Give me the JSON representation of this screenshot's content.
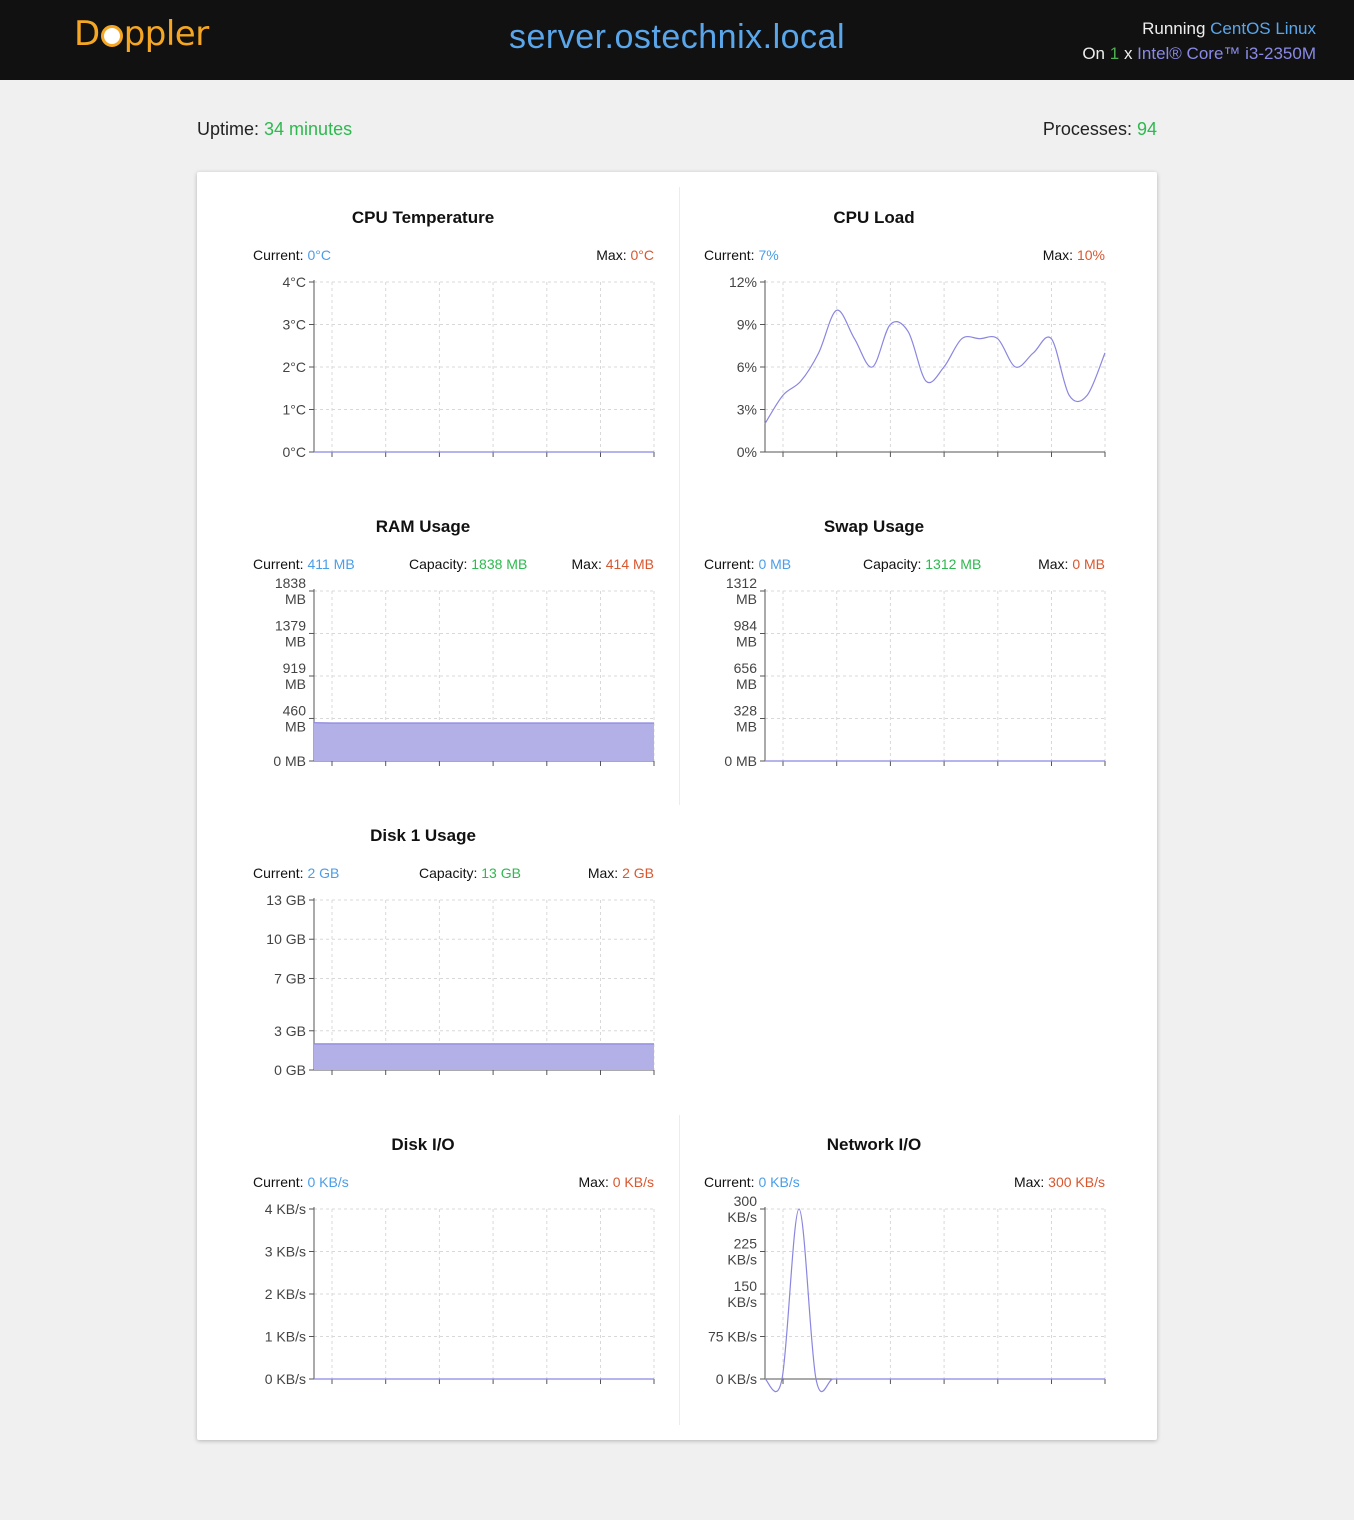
{
  "header": {
    "logo_text_before": "D",
    "logo_text_after": "ppler",
    "hostname": "server.ostechnix.local",
    "running_label": "Running",
    "os_name": "CentOS Linux",
    "on_label": "On",
    "cpu_count": "1",
    "x_label": "x",
    "cpu_model": "Intel® Core™ i3-2350M"
  },
  "stats": {
    "uptime_label": "Uptime:",
    "uptime_value": "34 minutes",
    "processes_label": "Processes:",
    "processes_value": "94"
  },
  "colors": {
    "current": "#4a9ee8",
    "capacity": "#2eb84f",
    "max": "#d9572e",
    "series_line": "#8a86e0",
    "series_fill": "#b3b0e8"
  },
  "panels": {
    "cpu_temp": {
      "title": "CPU Temperature",
      "current_label": "Current:",
      "current_value": "0°C",
      "max_label": "Max:",
      "max_value": "0°C"
    },
    "cpu_load": {
      "title": "CPU Load",
      "current_label": "Current:",
      "current_value": "7%",
      "max_label": "Max:",
      "max_value": "10%"
    },
    "ram": {
      "title": "RAM Usage",
      "current_label": "Current:",
      "current_value": "411 MB",
      "capacity_label": "Capacity:",
      "capacity_value": "1838 MB",
      "max_label": "Max:",
      "max_value": "414 MB"
    },
    "swap": {
      "title": "Swap Usage",
      "current_label": "Current:",
      "current_value": "0 MB",
      "capacity_label": "Capacity:",
      "capacity_value": "1312 MB",
      "max_label": "Max:",
      "max_value": "0 MB"
    },
    "disk1": {
      "title": "Disk 1 Usage",
      "current_label": "Current:",
      "current_value": "2 GB",
      "capacity_label": "Capacity:",
      "capacity_value": "13 GB",
      "max_label": "Max:",
      "max_value": "2 GB"
    },
    "disk_io": {
      "title": "Disk I/O",
      "current_label": "Current:",
      "current_value": "0 KB/s",
      "max_label": "Max:",
      "max_value": "0 KB/s"
    },
    "net_io": {
      "title": "Network I/O",
      "current_label": "Current:",
      "current_value": "0 KB/s",
      "max_label": "Max:",
      "max_value": "300 KB/s"
    }
  },
  "chart_data": [
    {
      "id": "cpu_temp",
      "type": "line",
      "title": "CPU Temperature",
      "ylim": [
        0,
        4
      ],
      "yticks": [
        0,
        1,
        2,
        3,
        4
      ],
      "ytick_labels": [
        "0°C",
        "1°C",
        "2°C",
        "3°C",
        "4°C"
      ],
      "series": [
        {
          "values": [
            0,
            0,
            0,
            0,
            0,
            0,
            0,
            0,
            0,
            0,
            0,
            0,
            0,
            0,
            0,
            0,
            0,
            0,
            0,
            0,
            0
          ]
        }
      ],
      "fill": false,
      "grid": true
    },
    {
      "id": "cpu_load",
      "type": "line",
      "title": "CPU Load",
      "ylim": [
        0,
        12
      ],
      "yticks": [
        0,
        3,
        6,
        9,
        12
      ],
      "ytick_labels": [
        "0%",
        "3%",
        "6%",
        "9%",
        "12%"
      ],
      "series": [
        {
          "values": [
            2,
            4,
            5,
            7,
            10,
            8,
            6,
            9,
            8.5,
            5,
            6,
            8,
            8,
            8,
            6,
            7,
            8,
            4,
            4,
            7
          ]
        }
      ],
      "fill": false,
      "grid": true
    },
    {
      "id": "ram",
      "type": "area",
      "title": "RAM Usage",
      "ylim": [
        0,
        1838
      ],
      "yticks": [
        0,
        460,
        919,
        1379,
        1838
      ],
      "ytick_labels": [
        [
          "0 MB"
        ],
        [
          "460",
          "MB"
        ],
        [
          "919",
          "MB"
        ],
        [
          "1379",
          "MB"
        ],
        [
          "1838",
          "MB"
        ]
      ],
      "series": [
        {
          "values": [
            414,
            411,
            411,
            411,
            411,
            411,
            411,
            411,
            411,
            411,
            411,
            411,
            411,
            411,
            411,
            411,
            411,
            411,
            411,
            411,
            411
          ]
        }
      ],
      "fill": true,
      "grid": true
    },
    {
      "id": "swap",
      "type": "area",
      "title": "Swap Usage",
      "ylim": [
        0,
        1312
      ],
      "yticks": [
        0,
        328,
        656,
        984,
        1312
      ],
      "ytick_labels": [
        [
          "0 MB"
        ],
        [
          "328",
          "MB"
        ],
        [
          "656",
          "MB"
        ],
        [
          "984",
          "MB"
        ],
        [
          "1312",
          "MB"
        ]
      ],
      "series": [
        {
          "values": [
            0,
            0,
            0,
            0,
            0,
            0,
            0,
            0,
            0,
            0,
            0,
            0,
            0,
            0,
            0,
            0,
            0,
            0,
            0,
            0,
            0
          ]
        }
      ],
      "fill": true,
      "grid": true
    },
    {
      "id": "disk1",
      "type": "area",
      "title": "Disk 1 Usage",
      "ylim": [
        0,
        13
      ],
      "yticks": [
        0,
        3,
        7,
        10,
        13
      ],
      "ytick_labels": [
        [
          "0 GB"
        ],
        [
          "3 GB"
        ],
        [
          "7 GB"
        ],
        [
          "10 GB"
        ],
        [
          "13 GB"
        ]
      ],
      "series": [
        {
          "values": [
            2,
            2,
            2,
            2,
            2,
            2,
            2,
            2,
            2,
            2,
            2,
            2,
            2,
            2,
            2,
            2,
            2,
            2,
            2,
            2,
            2
          ]
        }
      ],
      "fill": true,
      "grid": true
    },
    {
      "id": "disk_io",
      "type": "line",
      "title": "Disk I/O",
      "ylim": [
        0,
        4
      ],
      "yticks": [
        0,
        1,
        2,
        3,
        4
      ],
      "ytick_labels": [
        [
          "0 KB/s"
        ],
        [
          "1 KB/s"
        ],
        [
          "2 KB/s"
        ],
        [
          "3 KB/s"
        ],
        [
          "4 KB/s"
        ]
      ],
      "series": [
        {
          "values": [
            0,
            0,
            0,
            0,
            0,
            0,
            0,
            0,
            0,
            0,
            0,
            0,
            0,
            0,
            0,
            0,
            0,
            0,
            0,
            0,
            0
          ]
        }
      ],
      "fill": false,
      "grid": true
    },
    {
      "id": "net_io",
      "type": "line",
      "title": "Network I/O",
      "ylim": [
        0,
        300
      ],
      "yticks": [
        0,
        75,
        150,
        225,
        300
      ],
      "ytick_labels": [
        [
          "0 KB/s"
        ],
        [
          "75 KB/s"
        ],
        [
          "150",
          "KB/s"
        ],
        [
          "225",
          "KB/s"
        ],
        [
          "300",
          "KB/s"
        ]
      ],
      "series": [
        {
          "values": [
            0,
            0,
            300,
            0,
            0,
            0,
            0,
            0,
            0,
            0,
            0,
            0,
            0,
            0,
            0,
            0,
            0,
            0,
            0,
            0,
            0
          ]
        }
      ],
      "fill": false,
      "grid": true
    }
  ]
}
